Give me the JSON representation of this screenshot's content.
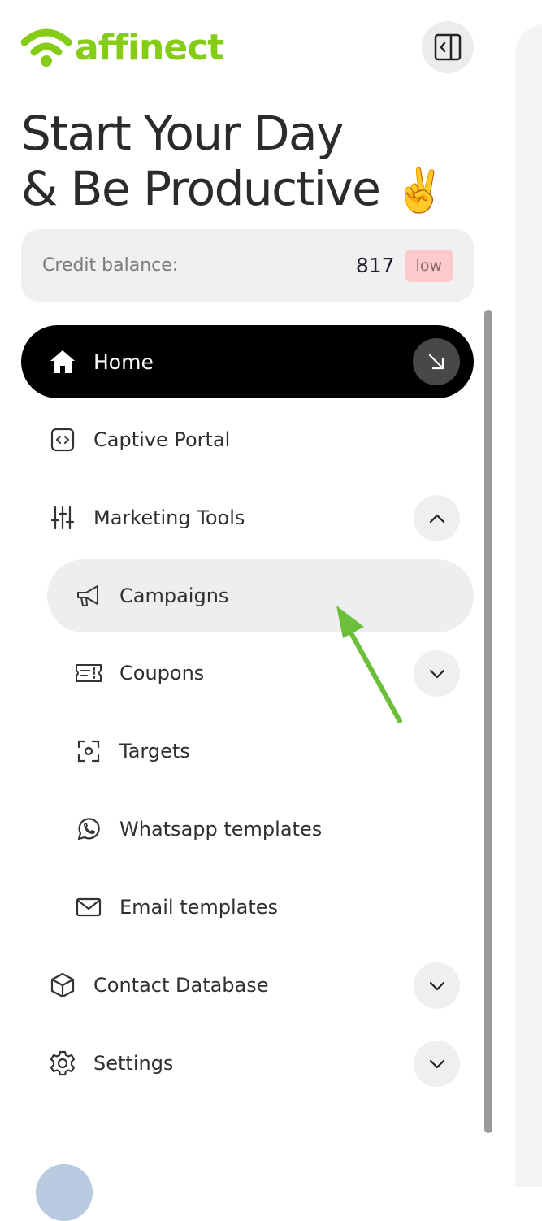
{
  "brand": {
    "name": "affinect",
    "logo_icon": "wifi-signal-icon",
    "accent_color": "#84cc16"
  },
  "header": {
    "collapse_icon": "sidebar-collapse-icon"
  },
  "greeting": {
    "line1": "Start Your Day",
    "line2": "& Be Productive",
    "emoji": "✌️"
  },
  "credit": {
    "label": "Credit balance:",
    "value": "817",
    "badge": "low",
    "badge_color": "#fccaca"
  },
  "nav": {
    "home": {
      "label": "Home",
      "icon": "home-icon",
      "action_icon": "arrow-down-right-icon"
    },
    "captive_portal": {
      "label": "Captive Portal",
      "icon": "code-icon"
    },
    "marketing_tools": {
      "label": "Marketing Tools",
      "icon": "sliders-icon",
      "expanded": true
    },
    "campaigns": {
      "label": "Campaigns",
      "icon": "megaphone-icon"
    },
    "coupons": {
      "label": "Coupons",
      "icon": "ticket-icon"
    },
    "targets": {
      "label": "Targets",
      "icon": "target-icon"
    },
    "whatsapp_templates": {
      "label": "Whatsapp templates",
      "icon": "whatsapp-icon"
    },
    "email_templates": {
      "label": "Email templates",
      "icon": "mail-icon"
    },
    "contact_database": {
      "label": "Contact Database",
      "icon": "cube-icon"
    },
    "settings": {
      "label": "Settings",
      "icon": "gear-icon"
    }
  },
  "annotation": {
    "arrow_color": "#6cbf3a"
  }
}
